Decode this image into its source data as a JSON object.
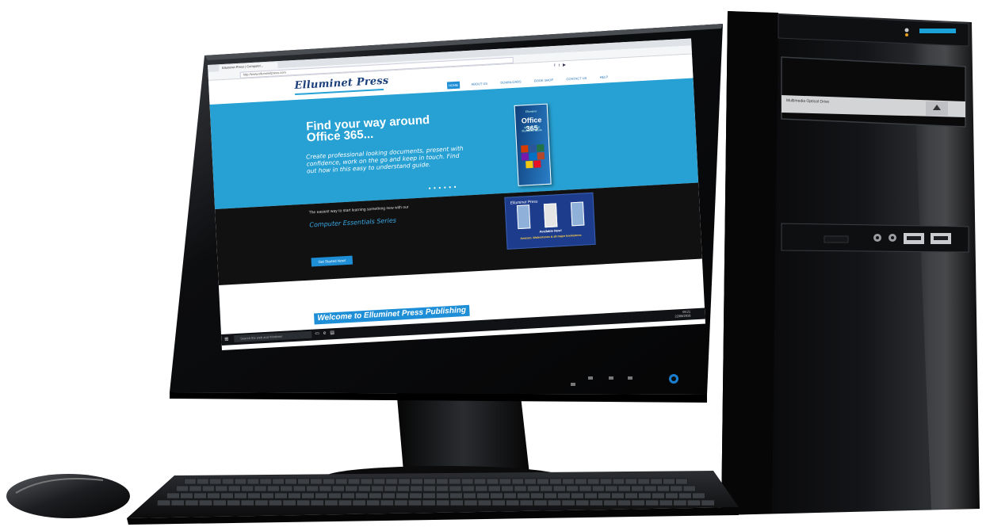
{
  "colors": {
    "site_blue": "#27a0d3",
    "nav_blue": "#1e8fd6",
    "logo_navy": "#1b3f7a",
    "tower_black": "#0d0d0f",
    "drive_label": "#d6d6d6"
  },
  "browser": {
    "tab_title": "Elluminet Press | Computer...",
    "address": "http://www.elluminetpress.com"
  },
  "site": {
    "logo": "Elluminet Press",
    "nav": [
      "HOME",
      "ABOUT US",
      "DOWNLOADS",
      "BOOK SHOP",
      "CONTACT US",
      "HELP"
    ],
    "social_icons": [
      "facebook-icon",
      "twitter-icon",
      "youtube-icon"
    ],
    "banner": {
      "title": "Find your way around Office 365...",
      "text": "Create professional looking documents, present with confidence, work on the go and keep in touch. Find out how in this easy to understand guide.",
      "book_brand": "Elluminet",
      "book_title": "Office 365",
      "book_subtitle": "Step by Step Illustrated Guide"
    },
    "tagline": "The easiest way to start learning something new with our",
    "series": "Computer Essentials Series",
    "cta": "Get Started Now!",
    "promo": {
      "brand": "Elluminet Press",
      "headline": "Available Now!",
      "subline": "Amazon, Waterstones & all major bookstores"
    },
    "welcome": "Welcome to Elluminet Press Publishing"
  },
  "taskbar": {
    "search": "Search the web and Windows",
    "time": "09:21",
    "date": "22/08/2016"
  },
  "tower": {
    "drive_label": "Multimedia Optical Drive"
  }
}
